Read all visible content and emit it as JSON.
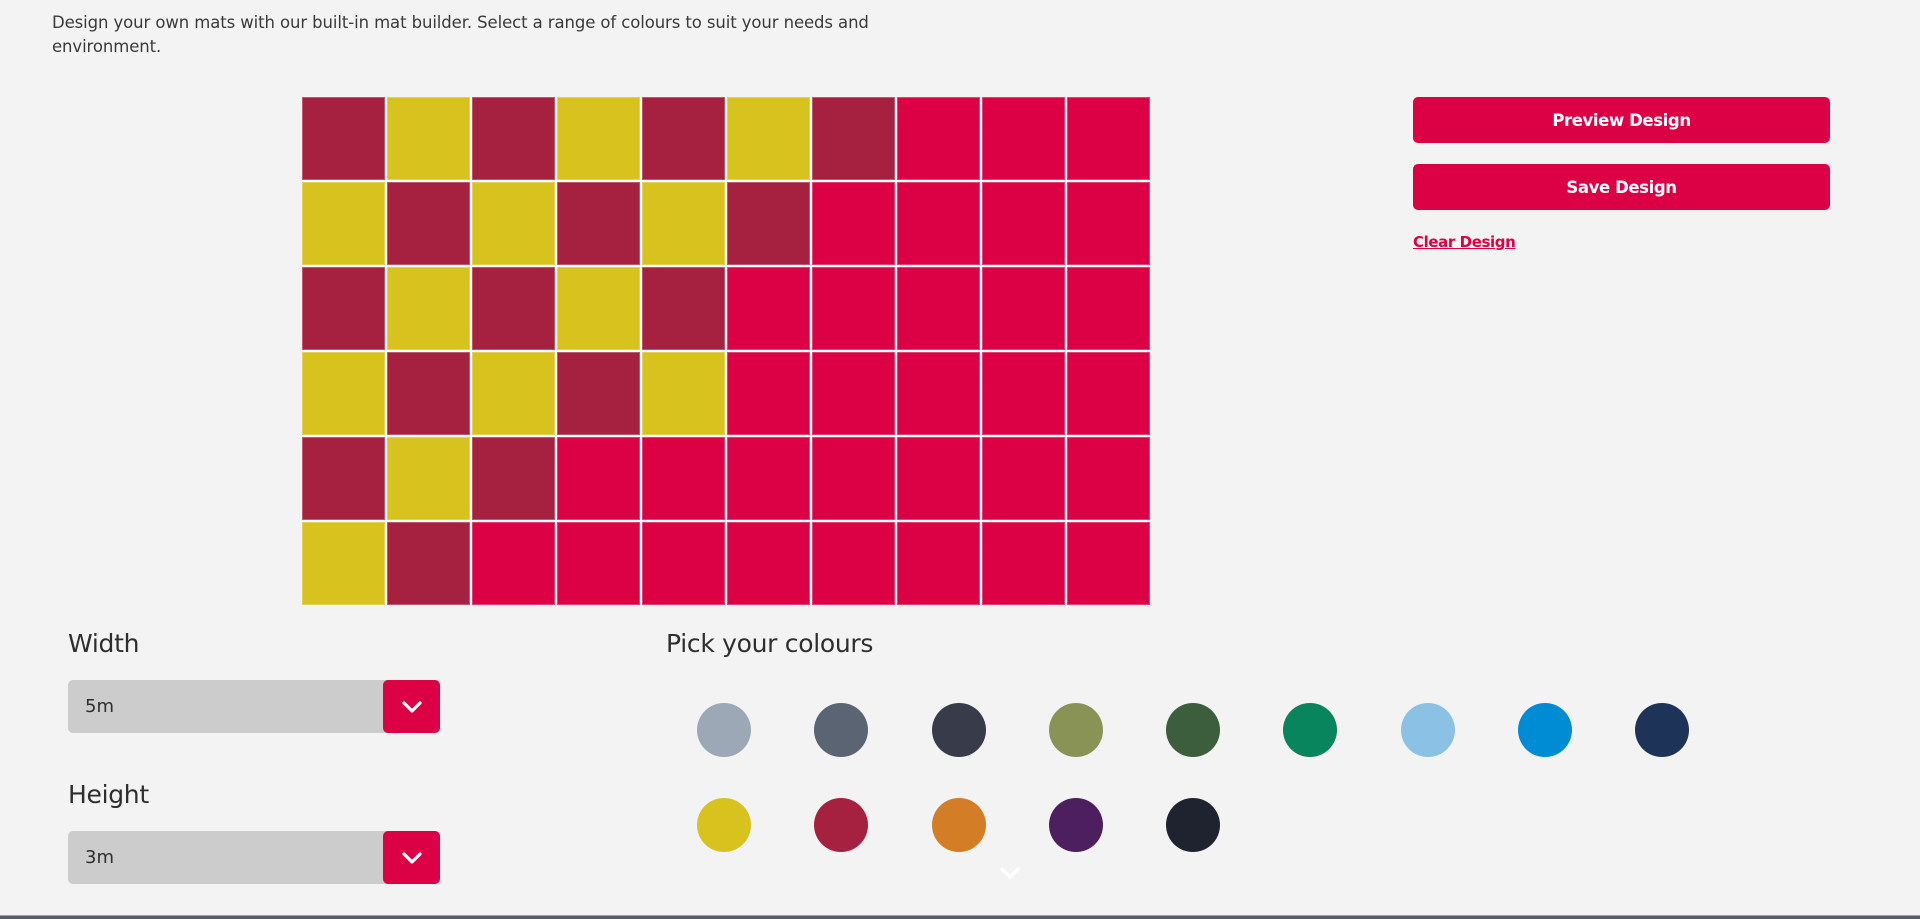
{
  "intro": {
    "text": "Design your own mats with our built-in mat builder. Select a range of colours to suit your needs and environment."
  },
  "theme": {
    "accent": "#dc0045",
    "background": "#f3f3f3",
    "select_bg": "#cccccc"
  },
  "palette": {
    "maroon": "#a6213f",
    "yellow": "#d7c21e",
    "red": "#dc0045"
  },
  "mat": {
    "columns": 10,
    "rows": 6,
    "cells": [
      [
        "maroon",
        "yellow",
        "maroon",
        "yellow",
        "maroon",
        "yellow",
        "maroon",
        "red",
        "red",
        "red"
      ],
      [
        "yellow",
        "maroon",
        "yellow",
        "maroon",
        "yellow",
        "maroon",
        "red",
        "red",
        "red",
        "red"
      ],
      [
        "maroon",
        "yellow",
        "maroon",
        "yellow",
        "maroon",
        "red",
        "red",
        "red",
        "red",
        "red"
      ],
      [
        "yellow",
        "maroon",
        "yellow",
        "maroon",
        "yellow",
        "red",
        "red",
        "red",
        "red",
        "red"
      ],
      [
        "maroon",
        "yellow",
        "maroon",
        "red",
        "red",
        "red",
        "red",
        "red",
        "red",
        "red"
      ],
      [
        "yellow",
        "maroon",
        "red",
        "red",
        "red",
        "red",
        "red",
        "red",
        "red",
        "red"
      ]
    ]
  },
  "actions": {
    "preview_label": "Preview Design",
    "save_label": "Save Design",
    "clear_label": "Clear Design"
  },
  "width_field": {
    "label": "Width",
    "value": "5m"
  },
  "height_field": {
    "label": "Height",
    "value": "3m"
  },
  "colours": {
    "title": "Pick your colours",
    "swatches": [
      {
        "name": "light-grey",
        "hex": "#9ca8b6"
      },
      {
        "name": "slate-grey",
        "hex": "#5a6472"
      },
      {
        "name": "charcoal",
        "hex": "#383c4a"
      },
      {
        "name": "olive",
        "hex": "#8a9356"
      },
      {
        "name": "forest-green",
        "hex": "#3c5e3c"
      },
      {
        "name": "emerald",
        "hex": "#08855c"
      },
      {
        "name": "sky-blue",
        "hex": "#8bc1e4"
      },
      {
        "name": "azure",
        "hex": "#008cd5"
      },
      {
        "name": "navy",
        "hex": "#1d3458"
      },
      {
        "name": "yellow",
        "hex": "#d7c21e"
      },
      {
        "name": "maroon",
        "hex": "#a6213f"
      },
      {
        "name": "orange",
        "hex": "#d37d27"
      },
      {
        "name": "purple",
        "hex": "#4d1f5e"
      },
      {
        "name": "black",
        "hex": "#1f2330"
      }
    ]
  },
  "icons": {
    "select_toggle": "chevron-down-icon",
    "more_colours": "chevron-down-icon"
  }
}
